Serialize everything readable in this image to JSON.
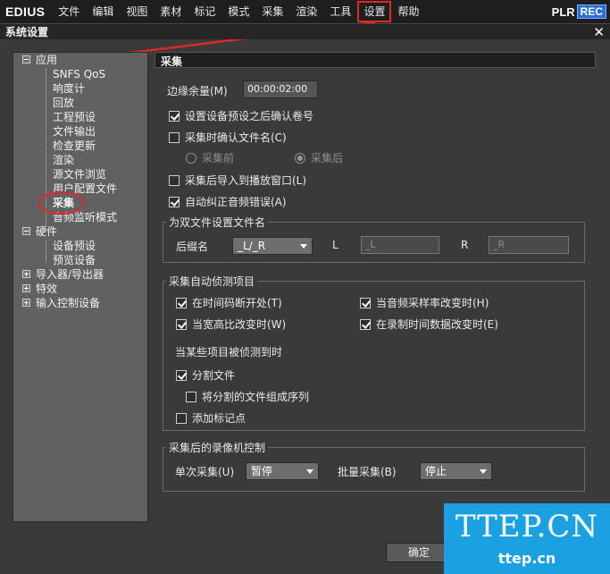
{
  "app": {
    "logo": "EDIUS",
    "menu": [
      "文件",
      "编辑",
      "视图",
      "素材",
      "标记",
      "模式",
      "采集",
      "渲染",
      "工具",
      "设置",
      "帮助"
    ],
    "badge_plr": "PLR",
    "badge_rec": "REC"
  },
  "dialog": {
    "title": "系统设置",
    "close": "✕"
  },
  "tree": {
    "app": "应用",
    "app_children": [
      "SNFS QoS",
      "响度计",
      "回放",
      "工程预设",
      "文件输出",
      "检查更新",
      "渲染",
      "源文件浏览",
      "用户配置文件",
      "采集",
      "音频监听模式"
    ],
    "hardware": "硬件",
    "hardware_children": [
      "设备预设",
      "预览设备"
    ],
    "importer": "导入器/导出器",
    "effects": "特效",
    "input_control": "输入控制设备"
  },
  "panel": {
    "title": "采集",
    "margin_label": "边缘余量(M)",
    "margin_value": "00:00:02:00",
    "cb_confirm_tape": "设置设备预设之后确认卷号",
    "cb_confirm_filename": "采集时确认文件名(C)",
    "radio_before": "采集前",
    "radio_after": "采集后",
    "cb_import_player": "采集后导入到播放窗口(L)",
    "cb_auto_audio": "自动纠正音频错误(A)",
    "dual_group": "为双文件设置文件名",
    "suffix_label": "后缀名",
    "suffix_value": "_L/_R",
    "l_label": "L",
    "l_value": "_L",
    "r_label": "R",
    "r_value": "_R",
    "detect_group": "采集自动侦测项目",
    "cb_timecode": "在时间码断开处(T)",
    "cb_samplerate": "当音频采样率改变时(H)",
    "cb_aspect": "当宽高比改变时(W)",
    "cb_rectime": "在录制时间数据改变时(E)",
    "when_detected": "当某些项目被侦测到时",
    "cb_split": "分割文件",
    "cb_sequence": "将分割的文件组成序列",
    "cb_marker": "添加标记点",
    "deck_group": "采集后的录像机控制",
    "single_label": "单次采集(U)",
    "single_value": "暂停",
    "batch_label": "批量采集(B)",
    "batch_value": "停止",
    "ok_button": "确定"
  },
  "state": {
    "confirm_tape": true,
    "confirm_filename": false,
    "radio_selected": "after",
    "import_player": false,
    "auto_audio": true,
    "timecode": true,
    "samplerate": true,
    "aspect": true,
    "rectime": true,
    "split": true,
    "sequence": false,
    "marker": false
  },
  "watermark": {
    "big": "TTEP.CN",
    "small": "ttep.cn"
  },
  "colors": {
    "annotation_red": "#e02828",
    "watermark_blue": "#1ba1e2",
    "rec_blue": "#2a6fd6"
  }
}
